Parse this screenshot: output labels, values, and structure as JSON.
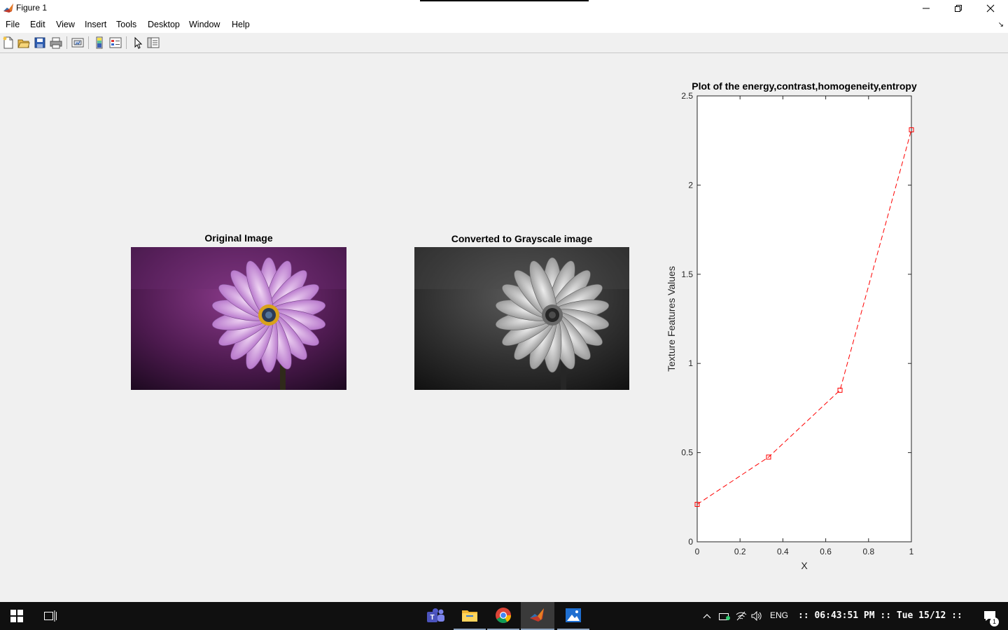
{
  "window": {
    "title": "Figure 1",
    "controls": {
      "minimize": "minimize",
      "maximize": "restore",
      "close": "close"
    }
  },
  "menu": [
    "File",
    "Edit",
    "View",
    "Insert",
    "Tools",
    "Desktop",
    "Window",
    "Help"
  ],
  "toolbar": [
    "new-figure-icon",
    "open-file-icon",
    "save-icon",
    "print-icon",
    "link-plot-icon",
    "insert-colorbar-icon",
    "insert-legend-icon",
    "edit-plot-icon",
    "show-plot-tools-icon"
  ],
  "subplots": {
    "original": {
      "title": "Original Image"
    },
    "grayscale": {
      "title": "Converted to Grayscale image"
    },
    "plot": {
      "title": "Plot of the energy,contrast,homogeneity,entropy"
    }
  },
  "chart_data": {
    "type": "line",
    "title": "Plot of the energy,contrast,homogeneity,entropy",
    "xlabel": "X",
    "ylabel": "Texture Features Values",
    "xlim": [
      0,
      1
    ],
    "ylim": [
      0,
      2.5
    ],
    "xticks": [
      "0",
      "0.2",
      "0.4",
      "0.6",
      "0.8",
      "1"
    ],
    "yticks": [
      "0",
      "0.5",
      "1",
      "1.5",
      "2",
      "2.5"
    ],
    "line_style": "dashed",
    "marker": "square",
    "color": "#ff0000",
    "x": [
      0,
      0.3333,
      0.6667,
      1
    ],
    "y": [
      0.21,
      0.475,
      0.85,
      2.31
    ]
  },
  "taskbar": {
    "apps": [
      "teams-icon",
      "file-explorer-icon",
      "chrome-icon",
      "matlab-icon",
      "photos-icon"
    ],
    "language": "ENG",
    "clock": ":: 06:43:51 PM :: Tue 15/12 ::",
    "notification_count": "1"
  }
}
